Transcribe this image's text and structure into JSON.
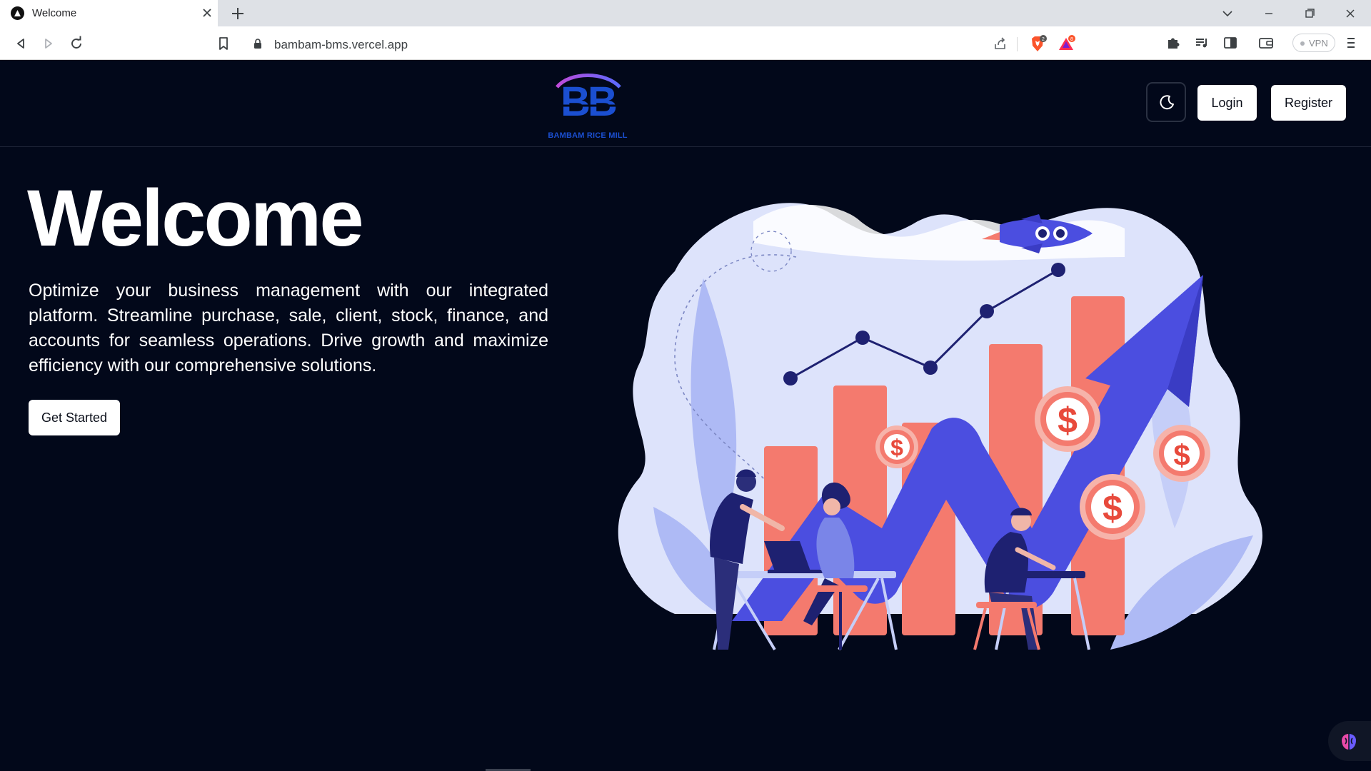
{
  "browser": {
    "tab_title": "Welcome",
    "url": "bambam-bms.vercel.app",
    "vpn_label": "VPN",
    "brave_badge": "2",
    "rewards_badge": "8"
  },
  "header": {
    "logo_letters": "BB",
    "logo_text": "BAMBAM RICE MILL",
    "login_label": "Login",
    "register_label": "Register"
  },
  "hero": {
    "title": "Welcome",
    "description": "Optimize your business management with our integrated platform. Streamline purchase, sale, client, stock, finance, and accounts for seamless operations. Drive growth and maximize efficiency with our comprehensive solutions.",
    "cta_label": "Get Started"
  },
  "colors": {
    "page_background": "#02081a",
    "accent_blue": "#4b4ee0",
    "chart_bar_red": "#f47a6e",
    "blob_lavender": "#dde3fb"
  },
  "icons": {
    "dollar_symbol": "$"
  }
}
